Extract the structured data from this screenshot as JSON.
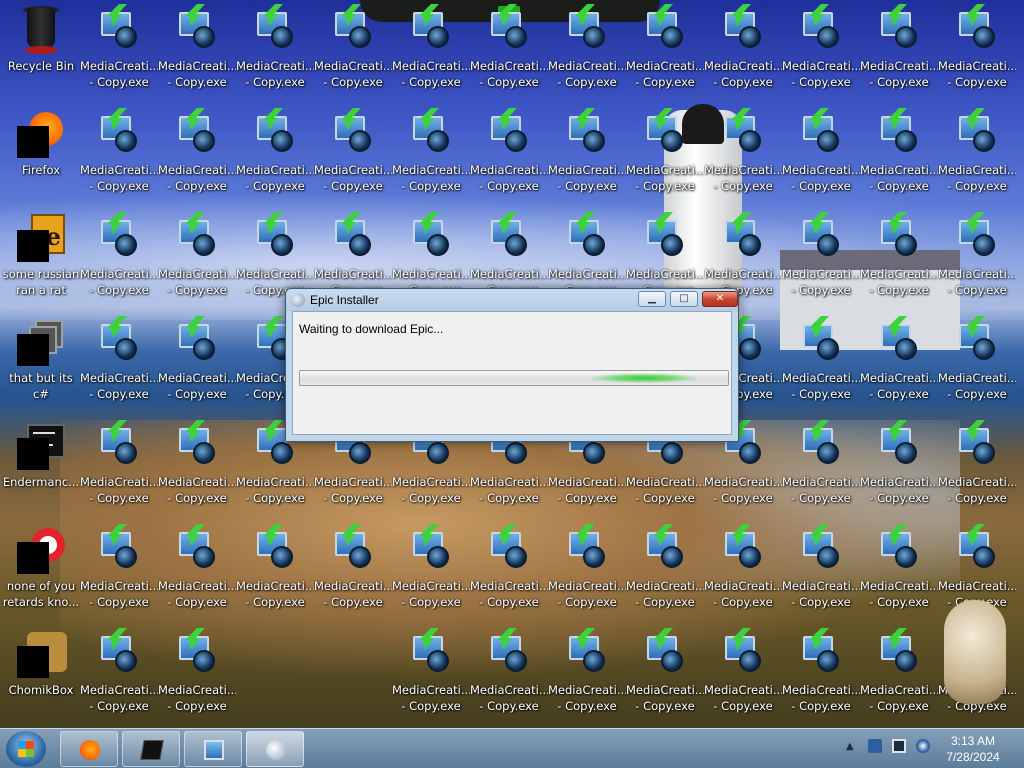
{
  "desktop": {
    "special_icons": [
      {
        "label": "Recycle Bin"
      },
      {
        "label": "Firefox"
      },
      {
        "label": "some russian ran a rat"
      },
      {
        "label": "that but its c#"
      },
      {
        "label": "Endermanc..."
      },
      {
        "label": "none of you retards kno..."
      },
      {
        "label": "ChomikBox"
      }
    ],
    "file_icon": {
      "label": "MediaCreati... - Copy.exe",
      "icon": "media-creation-tool-icon"
    },
    "grid_gaps": [
      [
        6,
        3
      ],
      [
        6,
        4
      ]
    ]
  },
  "installer": {
    "title": "Epic Installer",
    "message": "Waiting to download Epic...",
    "progress_mode": "indeterminate",
    "progress_glow_position": 0.8,
    "minimize_label": "▁",
    "maximize_label": "□",
    "close_label": "✕"
  },
  "taskbar": {
    "pinned": [
      "start-orb",
      "firefox-icon",
      "terminal-icon",
      "media-creation-tool-icon",
      "installer-icon"
    ],
    "active": "installer-icon",
    "tray_expand_label": "▲",
    "clock": {
      "time": "3:13 AM",
      "date": "7/28/2024"
    }
  }
}
